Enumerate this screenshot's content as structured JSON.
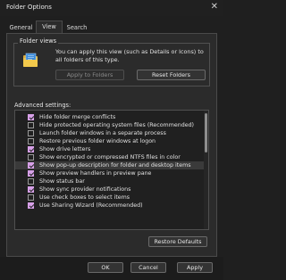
{
  "window": {
    "title": "Folder Options",
    "close_glyph": "✕"
  },
  "tabs": [
    "General",
    "View",
    "Search"
  ],
  "folder_views": {
    "legend": "Folder views",
    "icon": "folder-icon",
    "description": "You can apply this view (such as Details or Icons) to all folders of this type.",
    "apply_label": "Apply to Folders",
    "reset_label": "Reset Folders"
  },
  "advanced": {
    "label": "Advanced settings:",
    "items": [
      {
        "label": "Hide folder merge conflicts",
        "checked": true
      },
      {
        "label": "Hide protected operating system files (Recommended)",
        "checked": false
      },
      {
        "label": "Launch folder windows in a separate process",
        "checked": false
      },
      {
        "label": "Restore previous folder windows at logon",
        "checked": false
      },
      {
        "label": "Show drive letters",
        "checked": true
      },
      {
        "label": "Show encrypted or compressed NTFS files in color",
        "checked": false
      },
      {
        "label": "Show pop-up description for folder and desktop items",
        "checked": true
      },
      {
        "label": "Show preview handlers in preview pane",
        "checked": true
      },
      {
        "label": "Show status bar",
        "checked": false
      },
      {
        "label": "Show sync provider notifications",
        "checked": true
      },
      {
        "label": "Use check boxes to select items",
        "checked": false
      },
      {
        "label": "Use Sharing Wizard (Recommended)",
        "checked": true
      }
    ],
    "restore_label": "Restore Defaults"
  },
  "footer": {
    "ok": "OK",
    "cancel": "Cancel",
    "apply": "Apply"
  },
  "colors": {
    "accent": "#d7a0e8",
    "background": "#1f1f1f",
    "panel": "#2b2b2b"
  }
}
